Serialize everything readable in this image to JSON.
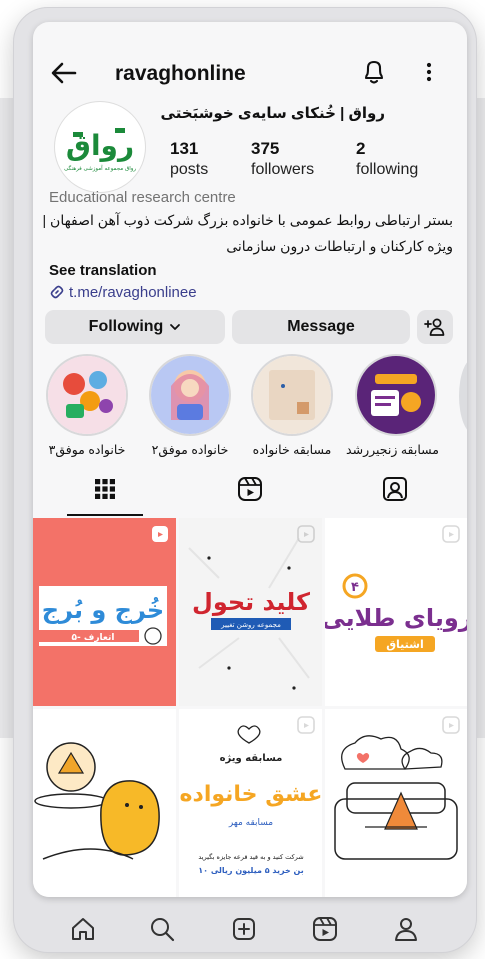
{
  "header": {
    "username": "ravaghonline",
    "back_icon": "arrow-left-icon",
    "bell_icon": "bell-icon",
    "more_icon": "more-vertical-icon"
  },
  "profile": {
    "display_name": "رواق | خُنکای سایه‌ی خوشبَختی",
    "avatar_logo_text": "رواق",
    "avatar_caption": "رواق مجموعه آموزشی فرهنگی",
    "stats": [
      {
        "value": "131",
        "label": "posts"
      },
      {
        "value": "375",
        "label": "followers"
      },
      {
        "value": "2",
        "label": "following"
      }
    ],
    "category": "Educational research centre",
    "bio_lines": [
      "بستر ارتباطی روابط عمومی با خانواده بزرگ شرکت ذوب آهن اصفهان |",
      "ویژه کارکنان و ارتباطات درون سازمانی"
    ],
    "see_translation": "See translation",
    "link": "t.me/ravaghonlinee"
  },
  "actions": {
    "following_label": "Following",
    "message_label": "Message",
    "add_user_icon": "add-person-icon"
  },
  "highlights": [
    {
      "label": "خانواده موفق۳"
    },
    {
      "label": "خانواده موفق۲"
    },
    {
      "label": "مسابقه خانواده"
    },
    {
      "label": "مسابقه زنجیررشد"
    }
  ],
  "tabs": [
    {
      "name": "grid-icon",
      "active": true
    },
    {
      "name": "reels-icon",
      "active": false
    },
    {
      "name": "tagged-icon",
      "active": false
    }
  ],
  "posts": [
    {
      "title": "خُرج و بُرج",
      "subtitle": "۵- اتعارف"
    },
    {
      "title": "کلید تحول",
      "subtitle": "مجموعه روشن تغییر"
    },
    {
      "number": "۴",
      "title": "رویای طلایی",
      "subtitle": "اشتیاق"
    },
    {
      "illustration": "character-with-cake"
    },
    {
      "heading": "مسابقه ویژه",
      "title": "عشق خانواده",
      "subtitle": "مسابقه مهر",
      "footer_line1": "شرکت کنید و به قید قرعه جایزه بگیرید",
      "footer_line2": "۱۰ بن خرید ۵ میلیون ریالی"
    },
    {
      "illustration": "character-on-sofa"
    }
  ],
  "bottom_nav": [
    {
      "name": "home-icon"
    },
    {
      "name": "search-icon"
    },
    {
      "name": "create-icon"
    },
    {
      "name": "reels-icon"
    },
    {
      "name": "profile-icon"
    }
  ],
  "colors": {
    "accent_link": "#3a3e8c",
    "brand_green": "#1b8a3a",
    "coral": "#f37268",
    "orange": "#f5a623",
    "purple": "#7b2f8f"
  }
}
